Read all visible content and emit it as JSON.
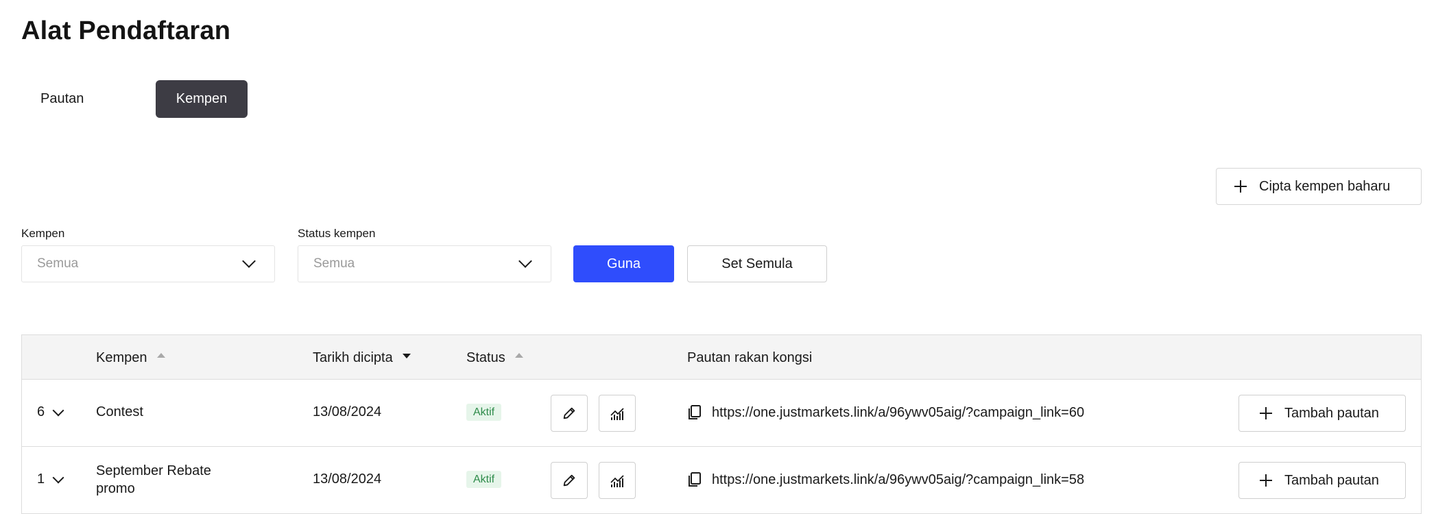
{
  "page": {
    "title": "Alat Pendaftaran"
  },
  "tabs": [
    {
      "label": "Pautan",
      "active": false
    },
    {
      "label": "Kempen",
      "active": true
    }
  ],
  "actions": {
    "create_campaign_label": "Cipta kempen baharu"
  },
  "filters": {
    "campaign": {
      "label": "Kempen",
      "placeholder": "Semua"
    },
    "status": {
      "label": "Status kempen",
      "placeholder": "Semua"
    },
    "apply_label": "Guna",
    "reset_label": "Set Semula"
  },
  "table": {
    "headers": {
      "campaign": "Kempen",
      "created": "Tarikh dicipta",
      "status": "Status",
      "partner_link": "Pautan rakan kongsi"
    },
    "rows": [
      {
        "count": "6",
        "campaign": "Contest",
        "campaign_line2": "",
        "created": "13/08/2024",
        "status": "Aktif",
        "link": "https://one.justmarkets.link/a/96ywv05aig/?campaign_link=60",
        "add_link_label": "Tambah pautan"
      },
      {
        "count": "1",
        "campaign": "September Rebate",
        "campaign_line2": "promo",
        "created": "13/08/2024",
        "status": "Aktif",
        "link": "https://one.justmarkets.link/a/96ywv05aig/?campaign_link=58",
        "add_link_label": "Tambah pautan"
      }
    ]
  },
  "colors": {
    "primary": "#2f4dfc",
    "active_tab": "#3d3c44",
    "badge_bg": "#e6f5ea",
    "badge_text": "#2e8b4a"
  },
  "icons": {
    "edit": "pencil-icon",
    "stats": "chart-icon",
    "copy": "copy-icon",
    "add": "plus-icon",
    "expand": "chevron-down-icon"
  }
}
